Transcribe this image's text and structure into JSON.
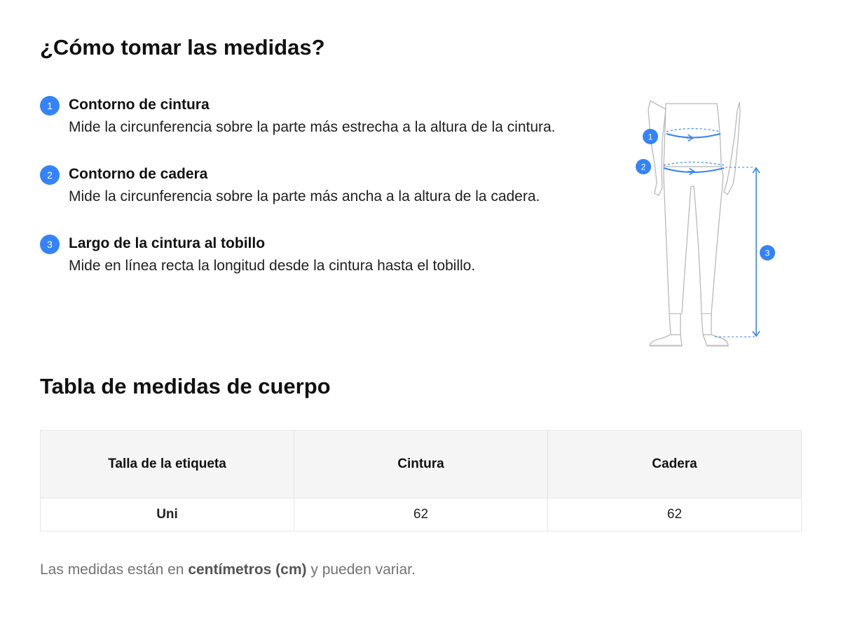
{
  "header": {
    "title": "¿Cómo tomar las medidas?"
  },
  "steps": [
    {
      "number": "1",
      "title": "Contorno de cintura",
      "description": "Mide la circunferencia sobre la parte más estrecha a la altura de la cintura."
    },
    {
      "number": "2",
      "title": "Contorno de cadera",
      "description": "Mide la circunferencia sobre la parte más ancha a la altura de la cadera."
    },
    {
      "number": "3",
      "title": "Largo de la cintura al tobillo",
      "description": "Mide en línea recta la longitud desde la cintura hasta el tobillo."
    }
  ],
  "figure": {
    "icon": "body-measurement-illustration",
    "markers": [
      "1",
      "2",
      "3"
    ],
    "accent_color": "#3483fa"
  },
  "table_section": {
    "title": "Tabla de medidas de cuerpo",
    "columns": [
      "Talla de la etiqueta",
      "Cintura",
      "Cadera"
    ],
    "rows": [
      [
        "Uni",
        "62",
        "62"
      ]
    ]
  },
  "footnote": {
    "prefix": "Las medidas están en ",
    "unit": "centímetros (cm)",
    "suffix": " y pueden variar."
  }
}
